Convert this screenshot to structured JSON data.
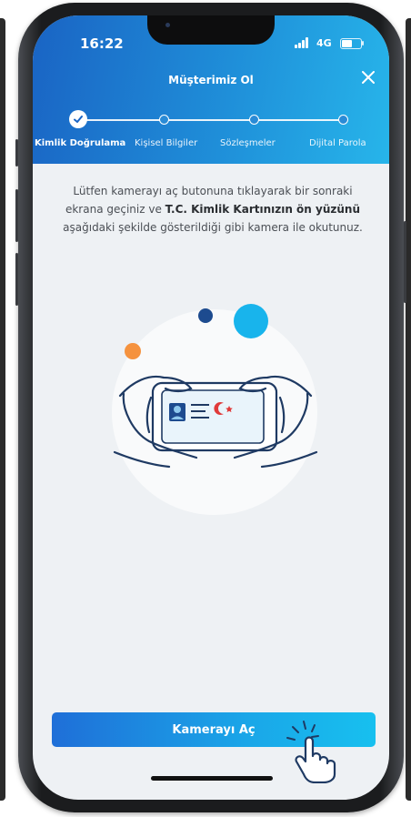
{
  "status_bar": {
    "time": "16:22",
    "network": "4G"
  },
  "header": {
    "title": "Müşterimiz Ol"
  },
  "stepper": {
    "steps": [
      {
        "label": "Kimlik Doğrulama",
        "state": "completed"
      },
      {
        "label": "Kişisel Bilgiler",
        "state": "pending"
      },
      {
        "label": "Sözleşmeler",
        "state": "pending"
      },
      {
        "label": "Dijital Parola",
        "state": "pending"
      }
    ]
  },
  "instruction": {
    "part1": "Lütfen kamerayı aç butonuna tıklayarak bir sonraki ekrana geçiniz ve ",
    "bold": "T.C. Kimlik Kartınızın ön yüzünü",
    "part2": " aşağıdaki şekilde gösterildiği gibi kamera ile okutunuz."
  },
  "cta": {
    "label": "Kamerayı Aç"
  },
  "colors": {
    "header_start": "#1a64c4",
    "header_end": "#27b5ea",
    "accent_orange": "#f5923e",
    "accent_navy": "#1d4b8f",
    "accent_cyan": "#18b4ec",
    "flag_red": "#e03a3a"
  },
  "icons": [
    "close-icon",
    "check-icon",
    "signal-icon",
    "battery-icon",
    "camera-id-illustration",
    "tap-hand-icon"
  ]
}
